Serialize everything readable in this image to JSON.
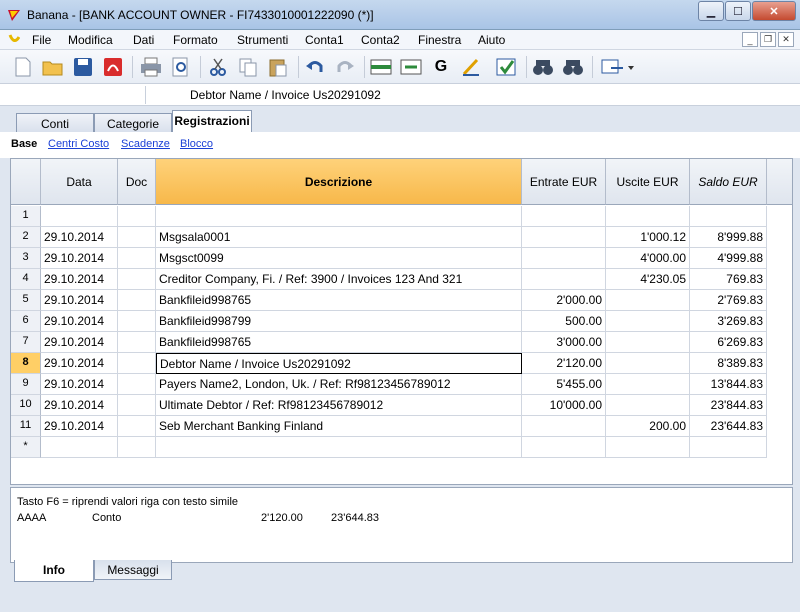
{
  "window": {
    "title": "Banana - [BANK ACCOUNT OWNER - FI7433010001222090 (*)]"
  },
  "menu": [
    "File",
    "Modifica",
    "Dati",
    "Formato",
    "Strumenti",
    "Conta1",
    "Conta2",
    "Finestra",
    "Aiuto"
  ],
  "cell_content": "Debtor Name /  Invoice Us20291092",
  "tables": [
    "Conti",
    "Categorie",
    "Registrazioni"
  ],
  "views": [
    "Base",
    "Centri Costo",
    "Scadenze",
    "Blocco"
  ],
  "columns": [
    "Data",
    "Doc",
    "Descrizione",
    "Entrate EUR",
    "Uscite EUR",
    "Saldo EUR"
  ],
  "rows": [
    {
      "n": "1",
      "date": "",
      "doc": "",
      "desc": "",
      "in": "",
      "out": "",
      "bal": ""
    },
    {
      "n": "2",
      "date": "29.10.2014",
      "doc": "",
      "desc": "Msgsala0001",
      "in": "",
      "out": "1'000.12",
      "bal": "8'999.88"
    },
    {
      "n": "3",
      "date": "29.10.2014",
      "doc": "",
      "desc": "Msgsct0099",
      "in": "",
      "out": "4'000.00",
      "bal": "4'999.88"
    },
    {
      "n": "4",
      "date": "29.10.2014",
      "doc": "",
      "desc": "Creditor Company, Fi.  / Ref: 3900 /  Invoices 123 And 321",
      "in": "",
      "out": "4'230.05",
      "bal": "769.83"
    },
    {
      "n": "5",
      "date": "29.10.2014",
      "doc": "",
      "desc": "Bankfileid998765",
      "in": "2'000.00",
      "out": "",
      "bal": "2'769.83"
    },
    {
      "n": "6",
      "date": "29.10.2014",
      "doc": "",
      "desc": "Bankfileid998799",
      "in": "500.00",
      "out": "",
      "bal": "3'269.83"
    },
    {
      "n": "7",
      "date": "29.10.2014",
      "doc": "",
      "desc": "Bankfileid998765",
      "in": "3'000.00",
      "out": "",
      "bal": "6'269.83"
    },
    {
      "n": "8",
      "date": "29.10.2014",
      "doc": "",
      "desc": "Debtor Name /  Invoice Us20291092",
      "in": "2'120.00",
      "out": "",
      "bal": "8'389.83"
    },
    {
      "n": "9",
      "date": "29.10.2014",
      "doc": "",
      "desc": "Payers Name2, London, Uk.  / Ref: Rf98123456789012",
      "in": "5'455.00",
      "out": "",
      "bal": "13'844.83"
    },
    {
      "n": "10",
      "date": "29.10.2014",
      "doc": "",
      "desc": "Ultimate Debtor / Ref: Rf98123456789012",
      "in": "10'000.00",
      "out": "",
      "bal": "23'844.83"
    },
    {
      "n": "11",
      "date": "29.10.2014",
      "doc": "",
      "desc": "Seb Merchant Banking Finland",
      "in": "",
      "out": "200.00",
      "bal": "23'644.83"
    },
    {
      "n": "*",
      "date": "",
      "doc": "",
      "desc": "",
      "in": "",
      "out": "",
      "bal": ""
    }
  ],
  "info": {
    "hint": "Tasto F6 = riprendi valori riga con testo simile",
    "account": "AAAA",
    "label": "Conto",
    "amount": "2'120.00",
    "balance": "23'644.83"
  },
  "bottom_tabs": [
    "Info",
    "Messaggi"
  ]
}
